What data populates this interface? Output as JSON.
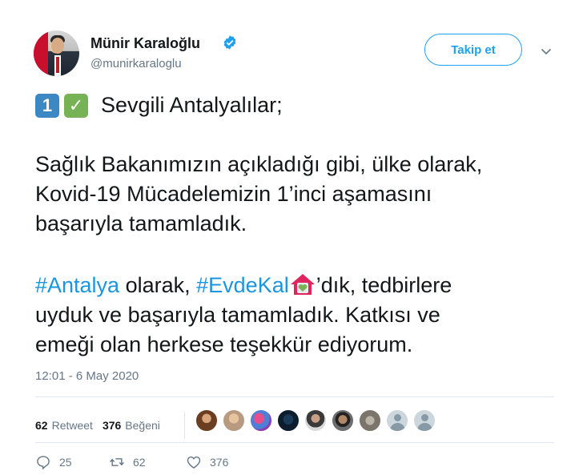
{
  "author": {
    "display_name": "Münir Karaloğlu",
    "handle": "@munirkaraloglu",
    "verified": true,
    "avatar_icon": "profile-photo"
  },
  "follow_button": {
    "label": "Takip et"
  },
  "more_menu_icon": "chevron-down-icon",
  "tweet": {
    "line1": "Sevgili Antalyalılar;",
    "line1_emojis": [
      "1",
      "✓"
    ],
    "paragraph2": [
      "Sağlık Bakanımızın açıkladığı gibi, ülke olarak,",
      "Kovid-19 Mücadelemizin 1’inci aşamasını",
      "başarıyla tamamladık."
    ],
    "paragraph3": {
      "hashtag1": "#Antalya",
      "text_a": " olarak, ",
      "hashtag2": "#EvdeKal",
      "text_b": "’dık, tedbirlere",
      "line2": "uyduk ve başarıyla tamamladık. Katkısı ve",
      "line3": "emeği olan herkese teşekkür ediyorum."
    },
    "timestamp": "12:01 - 6 May 2020"
  },
  "stats": {
    "retweets_count": "62",
    "retweets_label": "Retweet",
    "likes_count": "376",
    "likes_label": "Beğeni"
  },
  "actions": {
    "reply_count": "25",
    "retweet_count": "62",
    "like_count": "376"
  },
  "colors": {
    "accent": "#1da1f2",
    "hashtag": "#1b95e0",
    "muted": "#657786",
    "text": "#14171a"
  }
}
